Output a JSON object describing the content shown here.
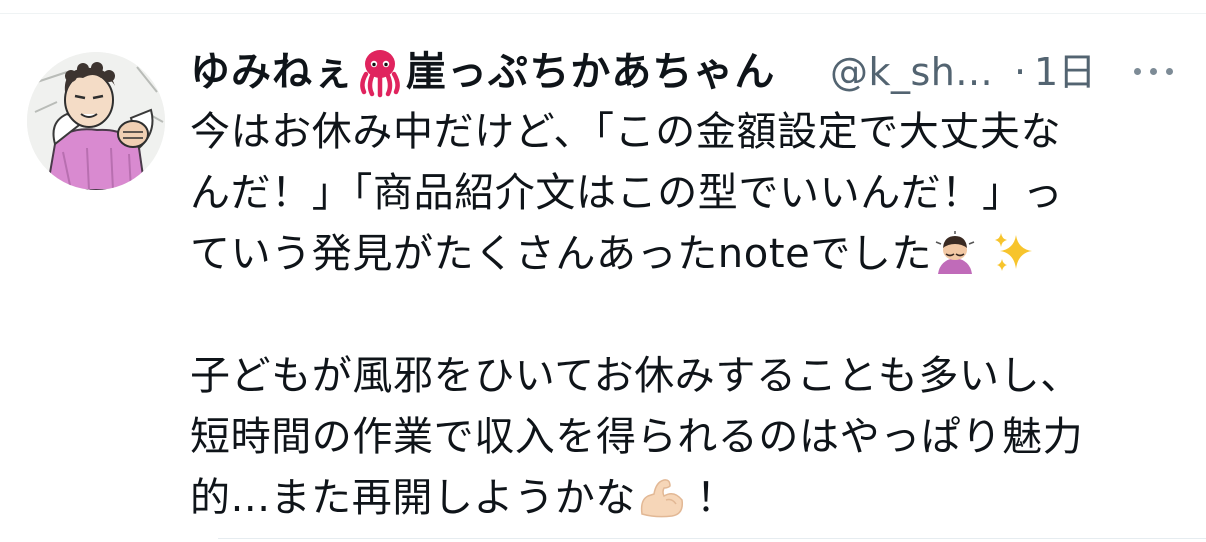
{
  "tweet": {
    "author": {
      "display_name_prefix": "ゆみねぇ",
      "display_name_suffix": "崖っぷちかあちゃん",
      "display_name_emoji": "octopus-icon",
      "handle": "@k_sh...",
      "avatar": "avatar"
    },
    "separator": "·",
    "time": "1日",
    "more_icon": "more-options-icon",
    "body_lines": [
      "今はお休み中だけど、「この金額設定で大丈夫な",
      "んだ！」「商品紹介文はこの型でいいんだ！」っ",
      "ていう発見がたくさんあったnoteでした",
      "子どもが風邪をひいてお休みすることも多いし、",
      "短時間の作業で収入を得られるのはやっぱり魅力",
      "的...また再開しようかな",
      "！"
    ],
    "emojis": [
      "person-bowing-icon",
      "sparkles-icon",
      "flexed-biceps-icon"
    ]
  },
  "colors": {
    "text": "#0f1419",
    "secondary_text": "#536471",
    "divider": "#eff3f4",
    "octopus": "#e0245e"
  }
}
